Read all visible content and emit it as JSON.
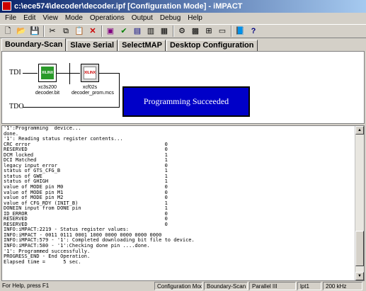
{
  "window": {
    "title": "c:\\ece574\\decoder\\decoder.ipf [Configuration Mode] - iMPACT"
  },
  "menu": [
    {
      "label": "File"
    },
    {
      "label": "Edit"
    },
    {
      "label": "View"
    },
    {
      "label": "Mode"
    },
    {
      "label": "Operations"
    },
    {
      "label": "Output"
    },
    {
      "label": "Debug"
    },
    {
      "label": "Help"
    }
  ],
  "toolbar": {
    "buttons": [
      "new-icon",
      "open-icon",
      "save-icon",
      "cut-icon",
      "copy-icon",
      "paste-icon",
      "delete-icon",
      "program-icon",
      "verify-icon",
      "erase-icon",
      "readback-icon",
      "id-icon",
      "config-icon",
      "chip-icon",
      "cable-icon",
      "window-icon",
      "help-icon",
      "whats-this-icon"
    ]
  },
  "tabs": [
    {
      "label": "Boundary-Scan",
      "active": true
    },
    {
      "label": "Slave Serial",
      "active": false
    },
    {
      "label": "SelectMAP",
      "active": false
    },
    {
      "label": "Desktop Configuration",
      "active": false
    }
  ],
  "chain": {
    "tdi_label": "TDI",
    "tdo_label": "TDO",
    "devices": [
      {
        "chip_text": "XILINX",
        "name": "xc3s200",
        "file": "decoder.bit",
        "color": "#2a9a2a"
      },
      {
        "chip_text": "XILINX",
        "name": "xcf02s",
        "file": "decoder_prom.mcs",
        "color": "#ffffff"
      }
    ],
    "status_message": "Programming Succeeded"
  },
  "console": {
    "lines": [
      "'1':Programming  device...",
      "done.",
      "'1': Reading status register contents...",
      "CRC error                                             0",
      "RESERVED                                              0",
      "DCM locked                                            1",
      "DCI Matched                                           1",
      "legacy input error                                    0",
      "status of GTS_CFG_B                                   1",
      "status of GWE                                         1",
      "status of GHIGH                                       1",
      "value of MODE pin M0                                  0",
      "value of MODE pin M1                                  0",
      "value of MODE pin M2                                  0",
      "value of CFG_RDY (INIT_B)                             1",
      "DONEIN input from DONE pin                            1",
      "ID_ERROR                                              0",
      "RESERVED                                              0",
      "RESERVED                                              0",
      "INFO:iMPACT:2219 - Status register values:",
      "INFO:iMPACT - 0011 0111 0001 1000 0000 0000 0000 0000",
      "INFO:iMPACT:579 - '1': Completed downloading bit file to device.",
      "INFO:iMPACT:580 - '1':Checking done pin ....done.",
      "'1': Programmed successfully.",
      "PROGRESS_END - End Operation.",
      "Elapsed time =      5 sec."
    ]
  },
  "statusbar": {
    "help": "For Help, press F1",
    "mode": "Configuration Mode",
    "scan": "Boundary-Scan",
    "cable": "Parallel III",
    "port": "lpt1",
    "speed": "200 kHz"
  }
}
